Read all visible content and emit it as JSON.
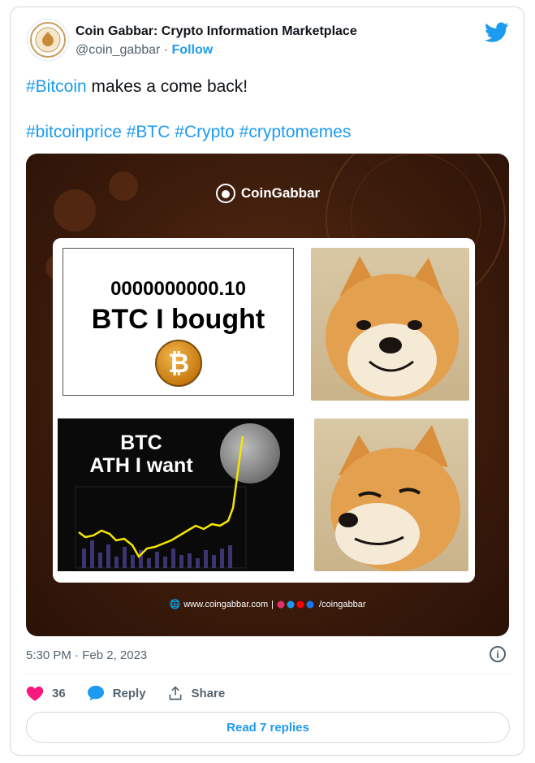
{
  "tweet": {
    "author": {
      "name": "Coin Gabbar: Crypto Information Marketplace",
      "handle": "@coin_gabbar",
      "separator": " · ",
      "follow_label": "Follow",
      "avatar_icon": "coin-gabbar-logo-icon"
    },
    "text_segments": [
      {
        "hashtag": "#Bitcoin",
        "plain": " makes a come back!"
      }
    ],
    "hashtags_line": [
      "#bitcoinprice",
      "#BTC",
      "#Crypto",
      "#cryptomemes"
    ],
    "media": {
      "brand": "CoinGabbar",
      "meme": {
        "top_left_number": "0000000000.10",
        "top_left_label": "BTC I bought",
        "coin_symbol": "₿",
        "bottom_left_label_1": "BTC",
        "bottom_left_label_2": "ATH I want"
      },
      "footer_url": "www.coingabbar.com",
      "footer_handle": "/coingabbar"
    },
    "timestamp": "5:30 PM · Feb 2, 2023",
    "actions": {
      "likes": "36",
      "reply_label": "Reply",
      "share_label": "Share"
    },
    "read_replies_label": "Read 7 replies",
    "colors": {
      "accent": "#1d9bf0",
      "like": "#f91880",
      "secondary": "#536471"
    }
  }
}
